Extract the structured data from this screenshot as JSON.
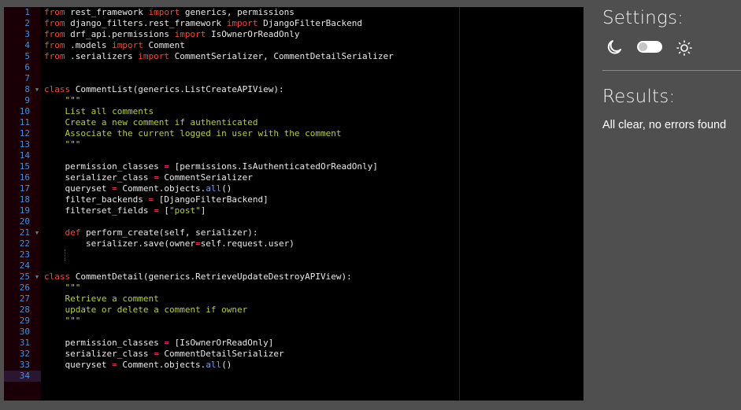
{
  "editor": {
    "language": "python",
    "active_line": 34,
    "fold_lines": [
      8,
      21,
      25
    ],
    "lines": [
      [
        [
          "kw",
          "from"
        ],
        [
          "t",
          " rest_framework "
        ],
        [
          "kw",
          "import"
        ],
        [
          "t",
          " generics, permissions"
        ]
      ],
      [
        [
          "kw",
          "from"
        ],
        [
          "t",
          " django_filters.rest_framework "
        ],
        [
          "kw",
          "import"
        ],
        [
          "t",
          " DjangoFilterBackend"
        ]
      ],
      [
        [
          "kw",
          "from"
        ],
        [
          "t",
          " drf_api.permissions "
        ],
        [
          "kw",
          "import"
        ],
        [
          "t",
          " IsOwnerOrReadOnly"
        ]
      ],
      [
        [
          "kw",
          "from"
        ],
        [
          "t",
          " .models "
        ],
        [
          "kw",
          "import"
        ],
        [
          "t",
          " Comment"
        ]
      ],
      [
        [
          "kw",
          "from"
        ],
        [
          "t",
          " .serializers "
        ],
        [
          "kw",
          "import"
        ],
        [
          "t",
          " CommentSerializer, CommentDetailSerializer"
        ]
      ],
      [],
      [],
      [
        [
          "kw",
          "class"
        ],
        [
          "t",
          " CommentList(generics.ListCreateAPIView):"
        ]
      ],
      [
        [
          "t",
          "    "
        ],
        [
          "str",
          "\"\"\""
        ]
      ],
      [
        [
          "t",
          "    "
        ],
        [
          "str",
          "List all comments"
        ]
      ],
      [
        [
          "t",
          "    "
        ],
        [
          "str",
          "Create a new comment if authenticated"
        ]
      ],
      [
        [
          "t",
          "    "
        ],
        [
          "str",
          "Associate the current logged in user with the comment"
        ]
      ],
      [
        [
          "t",
          "    "
        ],
        [
          "str",
          "\"\"\""
        ]
      ],
      [],
      [
        [
          "t",
          "    permission_classes "
        ],
        [
          "op",
          "="
        ],
        [
          "t",
          " [permissions.IsAuthenticatedOrReadOnly]"
        ]
      ],
      [
        [
          "t",
          "    serializer_class "
        ],
        [
          "op",
          "="
        ],
        [
          "t",
          " CommentSerializer"
        ]
      ],
      [
        [
          "t",
          "    queryset "
        ],
        [
          "op",
          "="
        ],
        [
          "t",
          " Comment.objects."
        ],
        [
          "bi",
          "all"
        ],
        [
          "t",
          "()"
        ]
      ],
      [
        [
          "t",
          "    filter_backends "
        ],
        [
          "op",
          "="
        ],
        [
          "t",
          " [DjangoFilterBackend]"
        ]
      ],
      [
        [
          "t",
          "    filterset_fields "
        ],
        [
          "op",
          "="
        ],
        [
          "t",
          " ["
        ],
        [
          "str",
          "\"post\""
        ],
        [
          "t",
          "]"
        ]
      ],
      [],
      [
        [
          "t",
          "    "
        ],
        [
          "kw",
          "def"
        ],
        [
          "t",
          " perform_create(self, serializer):"
        ]
      ],
      [
        [
          "t",
          "        serializer.save(owner"
        ],
        [
          "op",
          "="
        ],
        [
          "t",
          "self.request.user)"
        ]
      ],
      [],
      [],
      [
        [
          "kw",
          "class"
        ],
        [
          "t",
          " CommentDetail(generics.RetrieveUpdateDestroyAPIView):"
        ]
      ],
      [
        [
          "t",
          "    "
        ],
        [
          "str",
          "\"\"\""
        ]
      ],
      [
        [
          "t",
          "    "
        ],
        [
          "str",
          "Retrieve a comment"
        ]
      ],
      [
        [
          "t",
          "    "
        ],
        [
          "str",
          "update or delete a comment if owner"
        ]
      ],
      [
        [
          "t",
          "    "
        ],
        [
          "str",
          "\"\"\""
        ]
      ],
      [],
      [
        [
          "t",
          "    permission_classes "
        ],
        [
          "op",
          "="
        ],
        [
          "t",
          " [IsOwnerOrReadOnly]"
        ]
      ],
      [
        [
          "t",
          "    serializer_class "
        ],
        [
          "op",
          "="
        ],
        [
          "t",
          " CommentDetailSerializer"
        ]
      ],
      [
        [
          "t",
          "    queryset "
        ],
        [
          "op",
          "="
        ],
        [
          "t",
          " Comment.objects."
        ],
        [
          "bi",
          "all"
        ],
        [
          "t",
          "()"
        ]
      ],
      []
    ]
  },
  "settings": {
    "title": "Settings:",
    "dark_icon": "moon-icon",
    "light_icon": "sun-icon",
    "theme_toggle_on": false
  },
  "results": {
    "title": "Results:",
    "message": "All clear, no errors found"
  },
  "colors": {
    "keyword": "#f04a33",
    "string": "#b6cf3b",
    "operator": "#ec2d84",
    "builtin": "#6aa6e6",
    "line_number": "#4f8dd4",
    "editor_bg": "#000000",
    "page_bg": "#4f4f4f"
  }
}
